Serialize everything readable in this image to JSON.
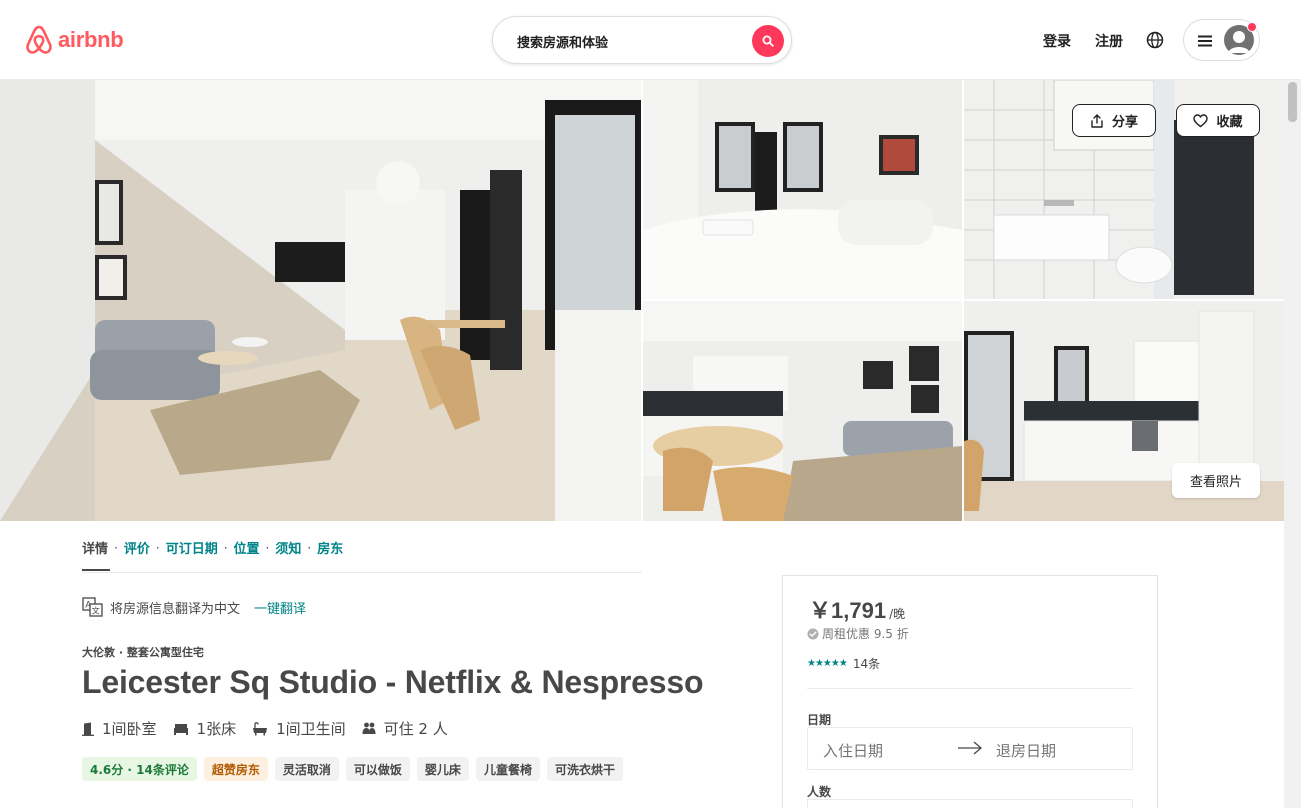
{
  "header": {
    "logo_text": "airbnb",
    "search_placeholder": "搜索房源和体验",
    "login": "登录",
    "signup": "注册"
  },
  "photos": {
    "share": "分享",
    "save": "收藏",
    "view_photos": "查看照片"
  },
  "tabs": [
    "详情",
    "评价",
    "可订日期",
    "位置",
    "须知",
    "房东"
  ],
  "translate": {
    "text": "将房源信息翻译为中文",
    "link": "一键翻译"
  },
  "listing": {
    "subtitle": "大伦敦 · 整套公寓型住宅",
    "title": "Leicester Sq Studio - Netflix & Nespresso",
    "facts": {
      "bedrooms": "1间卧室",
      "beds": "1张床",
      "baths": "1间卫生间",
      "guests": "可住 2 人"
    },
    "chips": [
      "4.6分 · 14条评论",
      "超赞房东",
      "灵活取消",
      "可以做饭",
      "婴儿床",
      "儿童餐椅",
      "可洗衣烘干"
    ]
  },
  "booking": {
    "price": "￥1,791",
    "per_night": "/晚",
    "discount": "周租优惠 9.5 折",
    "stars": "★★★★★",
    "review_count": "14条",
    "dates_label": "日期",
    "checkin_placeholder": "入住日期",
    "checkout_placeholder": "退房日期",
    "guests_label": "人数"
  },
  "colors": {
    "brand": "#ff5a5f",
    "search_button": "#ff385c",
    "link": "#008489",
    "text": "#484848"
  },
  "icons": [
    "airbnb-logo-icon",
    "search-icon",
    "globe-icon",
    "menu-icon",
    "avatar-icon",
    "share-icon",
    "heart-icon",
    "translate-icon",
    "door-icon",
    "bed-icon",
    "bath-icon",
    "guests-icon",
    "check-circle-icon",
    "arrow-right-icon"
  ]
}
